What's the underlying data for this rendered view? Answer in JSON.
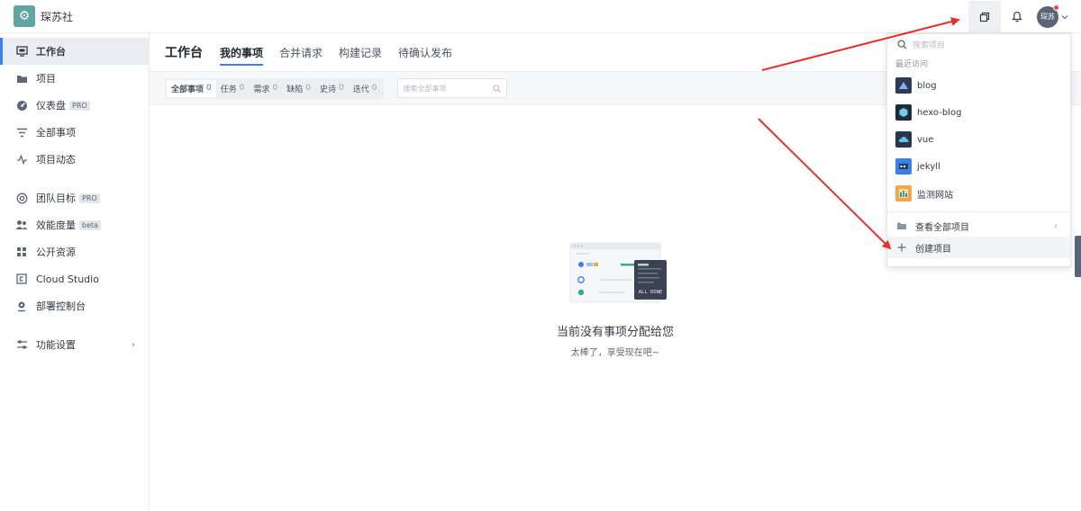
{
  "team": {
    "name": "琛苏社"
  },
  "header": {
    "avatar_text": "琛苏"
  },
  "sidebar": {
    "items": [
      {
        "label": "工作台",
        "icon": "workbench-icon",
        "active": true
      },
      {
        "label": "项目",
        "icon": "folder-icon"
      },
      {
        "label": "仪表盘",
        "icon": "dashboard-icon",
        "badge": "PRO"
      },
      {
        "label": "全部事项",
        "icon": "filter-icon"
      },
      {
        "label": "项目动态",
        "icon": "activity-icon"
      },
      {
        "label": "团队目标",
        "icon": "target-icon",
        "badge": "PRO"
      },
      {
        "label": "效能度量",
        "icon": "team-metrics-icon",
        "badge": "beta"
      },
      {
        "label": "公开资源",
        "icon": "grid-icon"
      },
      {
        "label": "Cloud Studio",
        "icon": "cloud-studio-icon"
      },
      {
        "label": "部署控制台",
        "icon": "deploy-icon"
      },
      {
        "label": "功能设置",
        "icon": "settings-icon"
      }
    ]
  },
  "main": {
    "title": "工作台",
    "tabs": [
      "我的事项",
      "合并请求",
      "构建记录",
      "待确认发布"
    ],
    "filters": [
      {
        "label": "全部事项",
        "count": "0"
      },
      {
        "label": "任务",
        "count": "0"
      },
      {
        "label": "需求",
        "count": "0"
      },
      {
        "label": "缺陷",
        "count": "0"
      },
      {
        "label": "史诗",
        "count": "0"
      },
      {
        "label": "迭代",
        "count": "0"
      }
    ],
    "search_placeholder": "搜索全部事项",
    "empty": {
      "title": "当前没有事项分配给您",
      "subtitle": "太棒了，享受现在吧~",
      "illus_text": "ALL DONE"
    }
  },
  "dropdown": {
    "search_placeholder": "搜索项目",
    "section_label": "最近访问",
    "projects": [
      {
        "name": "blog",
        "icon": "blog-project-icon",
        "color": "#2f3b52"
      },
      {
        "name": "hexo-blog",
        "icon": "hexo-project-icon",
        "color": "#1f2a3c"
      },
      {
        "name": "vue",
        "icon": "vue-project-icon",
        "color": "#2a3650"
      },
      {
        "name": "jekyll",
        "icon": "jekyll-project-icon",
        "color": "#3d7fe0"
      },
      {
        "name": "监测网站",
        "icon": "monitor-project-icon",
        "color": "#f0a64a"
      }
    ],
    "view_all": "查看全部项目",
    "create": "创建项目"
  },
  "colors": {
    "accent": "#3c7ff5",
    "arrow": "#e8302a"
  }
}
